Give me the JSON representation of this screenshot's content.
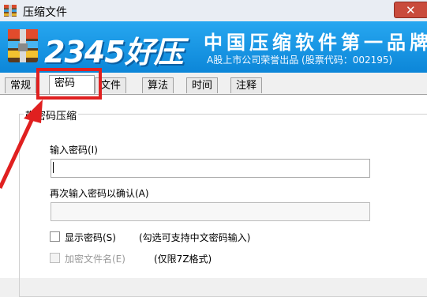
{
  "window": {
    "title": "压缩文件"
  },
  "banner": {
    "brand": "2345好压",
    "slogan": "中国压缩软件第一品牌",
    "subtitle": "A股上市公司荣誉出品 (股票代码：002195)"
  },
  "tabs": [
    "常规",
    "密码",
    "文件",
    "算法",
    "时间",
    "注释"
  ],
  "active_tab": "密码",
  "group": {
    "title": "带密码压缩"
  },
  "fields": {
    "password_label": "输入密码(I)",
    "password_value": "",
    "confirm_label": "再次输入密码以确认(A)",
    "confirm_value": ""
  },
  "options": {
    "show_password": "显示密码(S)",
    "show_password_hint": "(勾选可支持中文密码输入)",
    "encrypt_names": "加密文件名(E)",
    "encrypt_names_hint": "(仅限7Z格式)"
  },
  "colors": {
    "banner": "#1695e3",
    "highlight": "#e02020"
  }
}
